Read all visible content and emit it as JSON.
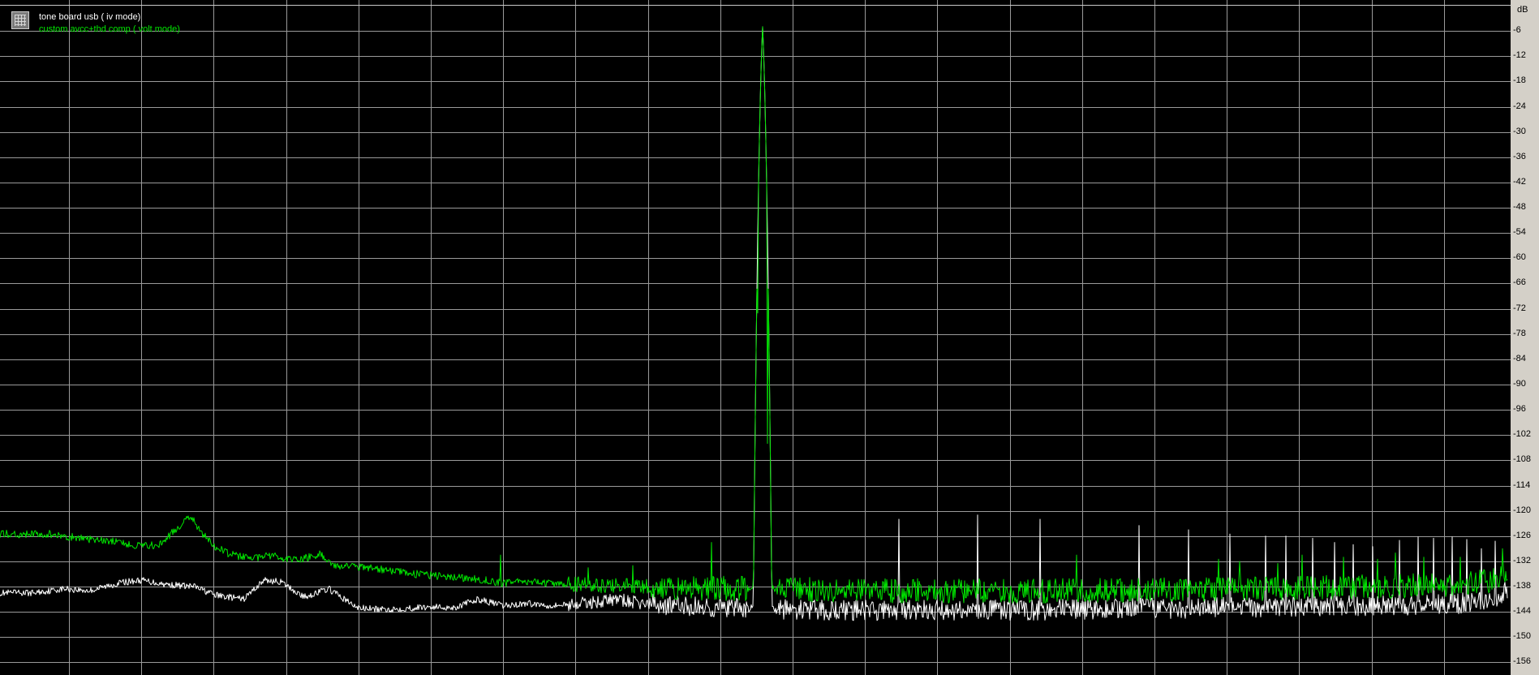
{
  "chart_data": {
    "type": "line",
    "ylabel": "dB",
    "ylim": [
      -156,
      0
    ],
    "yticks": [
      -6,
      -12,
      -18,
      -24,
      -30,
      -36,
      -42,
      -48,
      -54,
      -60,
      -66,
      -72,
      -78,
      -84,
      -90,
      -96,
      -102,
      -108,
      -114,
      -120,
      -126,
      -132,
      -138,
      -144,
      -150,
      -156
    ],
    "grid": true,
    "legend": "top-left",
    "series": [
      {
        "name": "tone board usb ( iv mode)",
        "color": "#ffffff",
        "floor_points": [
          [
            0,
            -139.5
          ],
          [
            40,
            -139.5
          ],
          [
            80,
            -138.5
          ],
          [
            110,
            -139
          ],
          [
            150,
            -137
          ],
          [
            175,
            -136.5
          ],
          [
            205,
            -137.5
          ],
          [
            240,
            -138
          ],
          [
            265,
            -140
          ],
          [
            300,
            -141
          ],
          [
            325,
            -136.5
          ],
          [
            345,
            -136.8
          ],
          [
            375,
            -140.5
          ],
          [
            405,
            -138.5
          ],
          [
            440,
            -143
          ],
          [
            470,
            -143.5
          ],
          [
            500,
            -143.2
          ],
          [
            530,
            -142.8
          ],
          [
            560,
            -143
          ],
          [
            590,
            -141
          ],
          [
            620,
            -142.6
          ],
          [
            650,
            -142
          ],
          [
            680,
            -142.5
          ],
          [
            720,
            -142
          ],
          [
            760,
            -141
          ],
          [
            790,
            -142
          ],
          [
            830,
            -142.5
          ],
          [
            900,
            -143.2
          ],
          [
            1000,
            -143.6
          ],
          [
            1100,
            -143.7
          ],
          [
            1200,
            -143.6
          ],
          [
            1300,
            -143.5
          ],
          [
            1400,
            -143.2
          ],
          [
            1500,
            -143
          ],
          [
            1600,
            -142.8
          ],
          [
            1700,
            -142.5
          ],
          [
            1800,
            -142
          ],
          [
            1840,
            -141
          ],
          [
            1858,
            -138.5
          ]
        ],
        "peaks": [
          [
            940,
            -5
          ],
          [
            1108,
            -122
          ],
          [
            1205,
            -121
          ],
          [
            1282,
            -122
          ],
          [
            1404,
            -123.5
          ],
          [
            1465,
            -124.5
          ],
          [
            1516,
            -125.5
          ],
          [
            1560,
            -126
          ],
          [
            1585,
            -126
          ],
          [
            1618,
            -126.5
          ],
          [
            1645,
            -127.5
          ],
          [
            1668,
            -128
          ],
          [
            1692,
            -128.5
          ],
          [
            1725,
            -127
          ],
          [
            1748,
            -126.2
          ],
          [
            1767,
            -126.5
          ],
          [
            1790,
            -126.2
          ],
          [
            1808,
            -126.8
          ],
          [
            1826,
            -129
          ],
          [
            1843,
            -127.2
          ]
        ],
        "noise_amp": 1.1
      },
      {
        "name": "custom avcc+thd comp ( volt mode)",
        "color": "#00e600",
        "floor_points": [
          [
            0,
            -125.5
          ],
          [
            60,
            -125.5
          ],
          [
            110,
            -126.8
          ],
          [
            150,
            -127.5
          ],
          [
            175,
            -128.5
          ],
          [
            195,
            -128
          ],
          [
            220,
            -124
          ],
          [
            235,
            -121
          ],
          [
            245,
            -124.5
          ],
          [
            265,
            -128.5
          ],
          [
            280,
            -130
          ],
          [
            300,
            -131
          ],
          [
            315,
            -131.2
          ],
          [
            335,
            -130.6
          ],
          [
            355,
            -131.5
          ],
          [
            375,
            -131.3
          ],
          [
            395,
            -130.2
          ],
          [
            415,
            -133.2
          ],
          [
            450,
            -133.4
          ],
          [
            480,
            -134.2
          ],
          [
            520,
            -135.2
          ],
          [
            560,
            -135.8
          ],
          [
            600,
            -136.5
          ],
          [
            620,
            -137.2
          ],
          [
            640,
            -136.8
          ],
          [
            680,
            -137.2
          ],
          [
            720,
            -137.5
          ],
          [
            760,
            -137.8
          ],
          [
            800,
            -138
          ],
          [
            830,
            -138.3
          ],
          [
            900,
            -138.4
          ],
          [
            1000,
            -138.7
          ],
          [
            1100,
            -139
          ],
          [
            1200,
            -139
          ],
          [
            1300,
            -139
          ],
          [
            1400,
            -138.9
          ],
          [
            1500,
            -138.6
          ],
          [
            1600,
            -138.3
          ],
          [
            1700,
            -138
          ],
          [
            1800,
            -137.5
          ],
          [
            1840,
            -136.5
          ],
          [
            1858,
            -134.5
          ]
        ],
        "peaks": [
          [
            617,
            -130.5
          ],
          [
            725,
            -133.5
          ],
          [
            780,
            -133
          ],
          [
            877,
            -127.5
          ],
          [
            934,
            -73
          ],
          [
            940,
            -5
          ],
          [
            946,
            -104
          ],
          [
            1327,
            -130.5
          ],
          [
            1502,
            -131.5
          ],
          [
            1528,
            -132
          ],
          [
            1575,
            -132.5
          ],
          [
            1605,
            -130.5
          ],
          [
            1656,
            -131
          ],
          [
            1698,
            -131.5
          ],
          [
            1720,
            -130
          ],
          [
            1755,
            -131
          ],
          [
            1800,
            -131
          ],
          [
            1852,
            -129
          ]
        ],
        "noise_amp": 1.3
      }
    ]
  },
  "colors": {
    "background": "#000000",
    "grid": "#9a9a9a",
    "right_panel": "#d4d0c8"
  },
  "icons": {
    "legend": "grid-icon"
  }
}
